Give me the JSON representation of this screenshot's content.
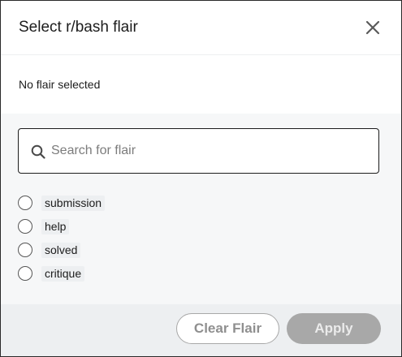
{
  "dialog": {
    "title": "Select r/bash flair",
    "close_icon": "close-icon",
    "status_text": "No flair selected"
  },
  "search": {
    "placeholder": "Search for flair",
    "value": "",
    "icon": "search-icon"
  },
  "flairs": [
    {
      "label": "submission",
      "selected": false
    },
    {
      "label": "help",
      "selected": false
    },
    {
      "label": "solved",
      "selected": false
    },
    {
      "label": "critique",
      "selected": false
    }
  ],
  "footer": {
    "clear_label": "Clear Flair",
    "apply_label": "Apply"
  },
  "colors": {
    "content_bg": "#f6f7f8",
    "footer_bg": "#edeff1",
    "disabled_button": "#a8a8a8"
  }
}
